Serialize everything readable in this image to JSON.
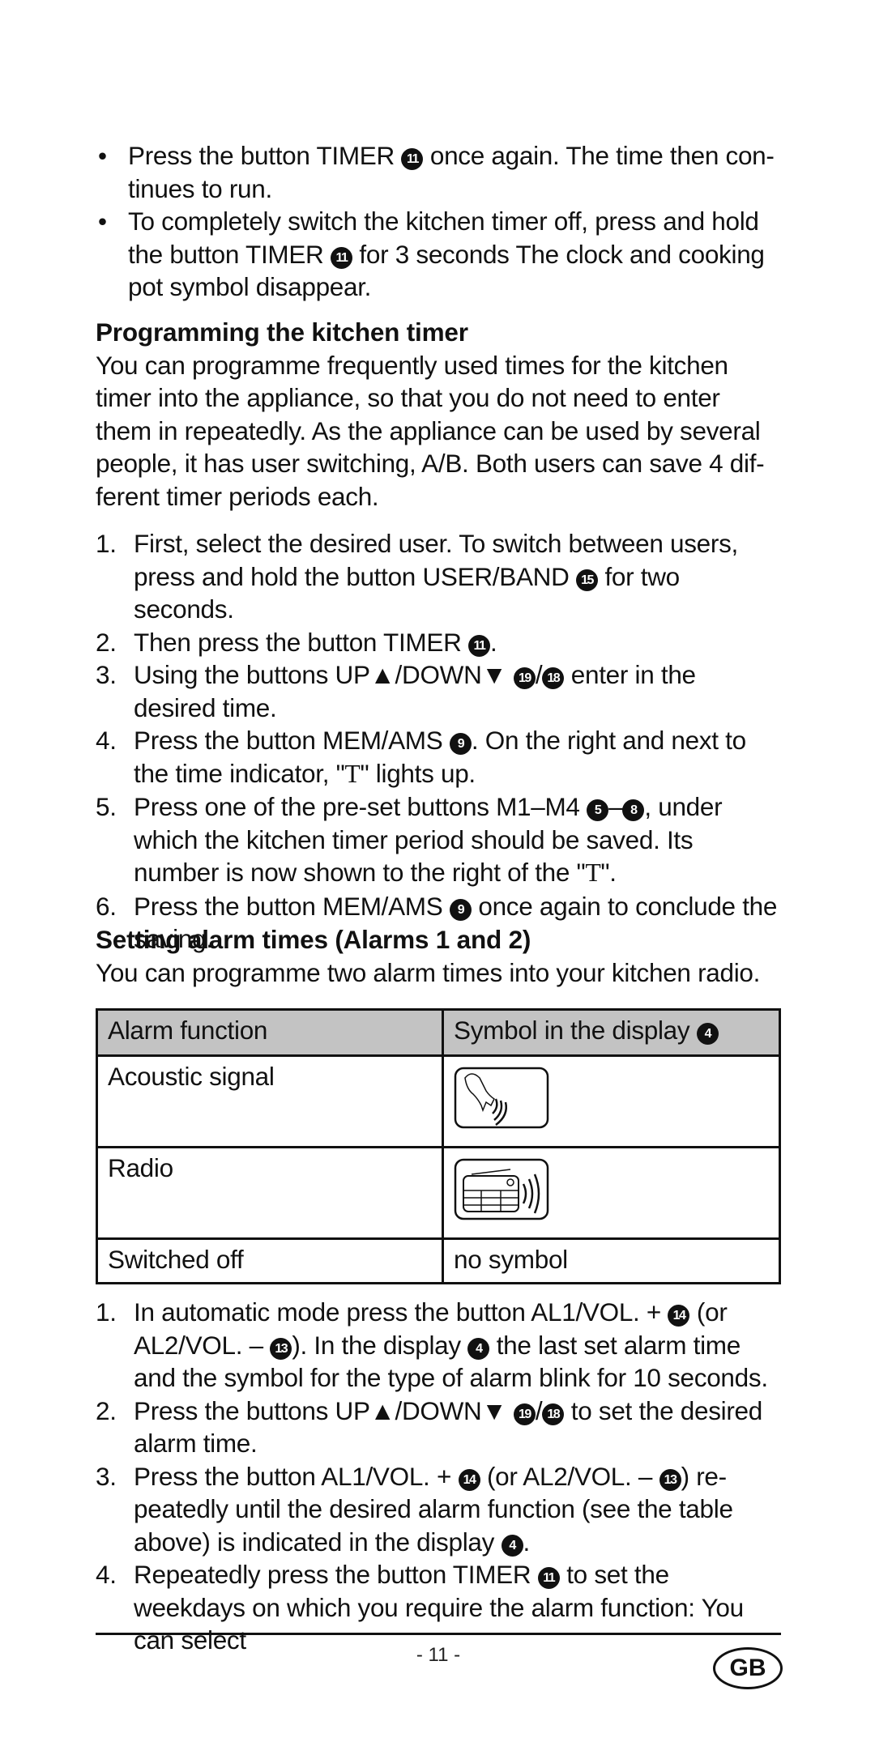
{
  "bullets": [
    {
      "pre": "Press the button TIMER ",
      "badge": "11",
      "post": " once again. The time then con-tinues to run."
    },
    {
      "pre": "To completely switch the kitchen timer off, press and hold the button TIMER ",
      "badge": "11",
      "post": " for 3 seconds The clock and cooking pot symbol disappear."
    }
  ],
  "section1": {
    "heading": "Programming the kitchen timer",
    "intro": "You can programme frequently used times for the kitchen timer into the appliance, so that you do not need to enter them in repeatedly. As the appliance can be used by several people, it has user switching, A/B. Both users can save 4 dif-ferent timer periods each.",
    "steps": [
      {
        "num": "1.",
        "a": "First, select the desired user. To switch between users, press and hold the button USER/BAND ",
        "b1": "15",
        "c": " for two seconds."
      },
      {
        "num": "2.",
        "a": "Then press the button TIMER ",
        "b1": "11",
        "c": "."
      },
      {
        "num": "3.",
        "a": "Using the buttons UP▲/DOWN▼ ",
        "b1": "19",
        "mid": "/",
        "b2": "18",
        "c": " enter in the desired time."
      },
      {
        "num": "4.",
        "a": "Press the button MEM/AMS ",
        "b1": "9",
        "c": ". On the right and next to the time indicator, \"",
        "t": "T",
        "d": "\" lights up."
      },
      {
        "num": "5.",
        "a": "Press one of the pre-set buttons M1–M4 ",
        "b1": "5",
        "mid": "–",
        "b2": "8",
        "c": ", under which the kitchen timer period should be saved. Its number is now shown to the right of the \"",
        "t": "T",
        "d": "\"."
      },
      {
        "num": "6.",
        "a": "Press the button MEM/AMS ",
        "b1": "9",
        "c": " once again to conclude the saving."
      }
    ]
  },
  "section2": {
    "heading": "Setting alarm times (Alarms 1 and 2)",
    "intro": "You can programme two alarm times into your kitchen radio.",
    "table": {
      "header": {
        "col1": "Alarm function",
        "col2": "Symbol in the display ",
        "col2_badge": "4"
      },
      "rows": [
        {
          "function": "Acoustic signal",
          "symbol_icon": "bell-icon"
        },
        {
          "function": "Radio",
          "symbol_icon": "radio-icon"
        },
        {
          "function": "Switched off",
          "symbol_text": "no symbol"
        }
      ]
    },
    "steps": [
      {
        "num": "1.",
        "a": "In automatic mode press the button AL1/VOL. + ",
        "b1": "14",
        "c": " (or AL2/VOL. – ",
        "b2": "13",
        "d": "). In the display ",
        "b3": "4",
        "e": " the last set alarm time and the symbol for the type of alarm blink for 10 seconds."
      },
      {
        "num": "2.",
        "a": "Press the buttons UP▲/DOWN▼ ",
        "b1": "19",
        "c": "/",
        "b2": "18",
        "d": " to set the desired alarm time."
      },
      {
        "num": "3.",
        "a": "Press the button AL1/VOL. + ",
        "b1": "14",
        "c": " (or AL2/VOL. – ",
        "b2": "13",
        "d": ") re-peatedly until the desired alarm function (see the table above) is indicated in the display ",
        "b3": "4",
        "e": "."
      },
      {
        "num": "4.",
        "a": "Repeatedly press the button TIMER ",
        "b1": "11",
        "c": " to set the weekdays on which you require the alarm function: You can select"
      }
    ]
  },
  "footer": {
    "page_number": "- 11 -",
    "language_badge": "GB"
  }
}
